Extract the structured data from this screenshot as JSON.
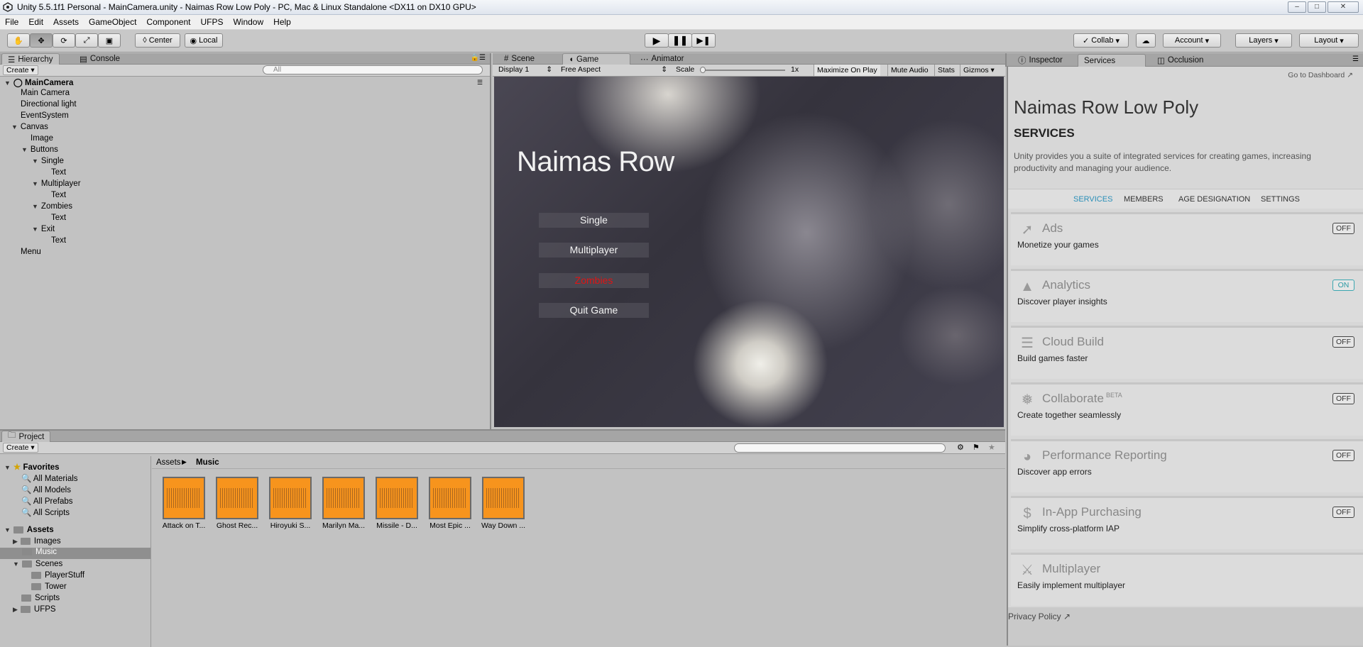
{
  "window": {
    "title": "Unity 5.5.1f1 Personal - MainCamera.unity - Naimas Row Low Poly - PC, Mac & Linux Standalone <DX11 on DX10 GPU>"
  },
  "menu": [
    "File",
    "Edit",
    "Assets",
    "GameObject",
    "Component",
    "UFPS",
    "Window",
    "Help"
  ],
  "toolbar": {
    "center": "Center",
    "local": "Local",
    "collab": "Collab",
    "account": "Account",
    "layers": "Layers",
    "layout": "Layout"
  },
  "hierarchy": {
    "tab": "Hierarchy",
    "console_tab": "Console",
    "create": "Create",
    "search_placeholder": "All",
    "scene": "MainCamera",
    "items": [
      "Main Camera",
      "Directional light",
      "EventSystem",
      "Canvas",
      "Image",
      "Buttons",
      "Single",
      "Text",
      "Multiplayer",
      "Text",
      "Zombies",
      "Text",
      "Exit",
      "Text",
      "Menu"
    ]
  },
  "viewtabs": {
    "scene": "Scene",
    "game": "Game",
    "animator": "Animator"
  },
  "gamebar": {
    "display": "Display 1",
    "aspect": "Free Aspect",
    "scale_label": "Scale",
    "scale_value": "1x",
    "maximize": "Maximize On Play",
    "mute": "Mute Audio",
    "stats": "Stats",
    "gizmos": "Gizmos"
  },
  "game": {
    "title": "Naimas Row",
    "buttons": [
      "Single",
      "Multiplayer",
      "Zombies",
      "Quit Game"
    ],
    "highlight_color": "#e01414"
  },
  "inspector_tabs": {
    "inspector": "Inspector",
    "services": "Services",
    "occlusion": "Occlusion"
  },
  "services": {
    "dashboard": "Go to Dashboard",
    "project": "Naimas Row Low Poly",
    "heading": "SERVICES",
    "intro": "Unity provides you a suite of integrated services for creating games, increasing productivity and managing your audience.",
    "nav": [
      "SERVICES",
      "MEMBERS",
      "AGE DESIGNATION",
      "SETTINGS"
    ],
    "items": [
      {
        "name": "Ads",
        "desc": "Monetize your games",
        "state": "OFF",
        "icon": "ads-icon"
      },
      {
        "name": "Analytics",
        "desc": "Discover player insights",
        "state": "ON",
        "icon": "analytics-icon"
      },
      {
        "name": "Cloud Build",
        "desc": "Build games faster",
        "state": "OFF",
        "icon": "cloud-build-icon"
      },
      {
        "name": "Collaborate",
        "badge": "BETA",
        "desc": "Create together seamlessly",
        "state": "OFF",
        "icon": "collaborate-icon"
      },
      {
        "name": "Performance Reporting",
        "desc": "Discover app errors",
        "state": "OFF",
        "icon": "performance-icon"
      },
      {
        "name": "In-App Purchasing",
        "desc": "Simplify cross-platform IAP",
        "state": "OFF",
        "icon": "dollar-icon"
      },
      {
        "name": "Multiplayer",
        "desc": "Easily implement multiplayer",
        "state": "",
        "icon": "multiplayer-icon"
      }
    ],
    "privacy": "Privacy Policy"
  },
  "project": {
    "tab": "Project",
    "create": "Create",
    "favorites": "Favorites",
    "fav_items": [
      "All Materials",
      "All Models",
      "All Prefabs",
      "All Scripts"
    ],
    "assets": "Assets",
    "folders": [
      "Images",
      "Music",
      "Scenes",
      "PlayerStuff",
      "Tower",
      "Scripts",
      "UFPS"
    ],
    "breadcrumb": [
      "Assets",
      "Music"
    ],
    "files": [
      "Attack on T...",
      "Ghost Rec...",
      "Hiroyuki S...",
      "Marilyn Ma...",
      "Missile - D...",
      "Most Epic ...",
      "Way Down ..."
    ]
  }
}
